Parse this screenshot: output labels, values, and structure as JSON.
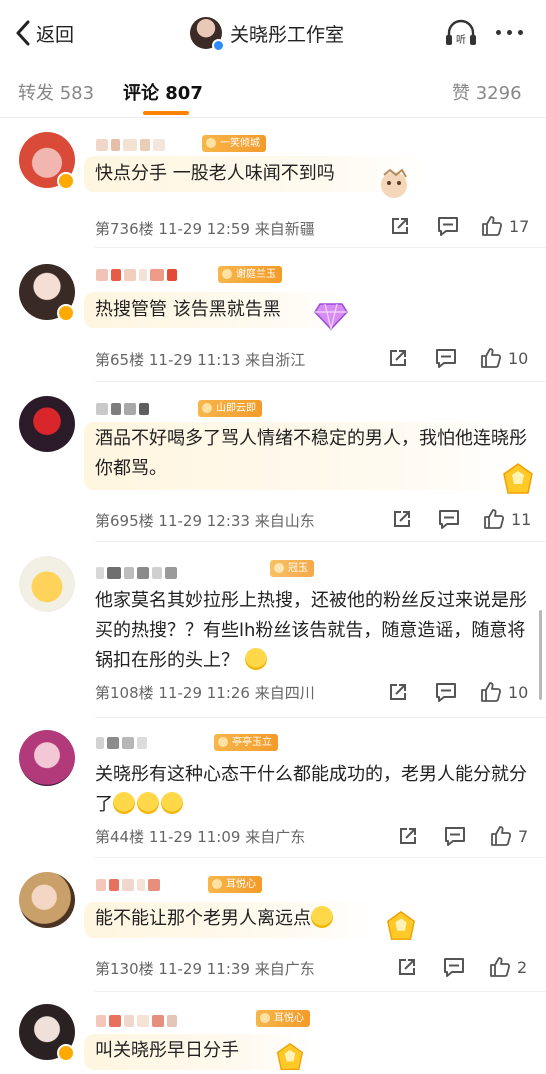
{
  "header": {
    "back_label": "返回",
    "title": "关晓彤工作室",
    "listen_label": "听"
  },
  "tabs": [
    {
      "label": "转发",
      "count": "583"
    },
    {
      "label": "评论",
      "count": "807"
    },
    {
      "label": "赞",
      "count": "3296"
    }
  ],
  "tab_labels": {
    "forward": "转发 583",
    "comments": "评论 807",
    "likes": "赞 3296"
  },
  "colors": {
    "accent": "#ff8200",
    "fan_badge": "#f5a93a",
    "verified": "#2f8cff"
  },
  "comments": [
    {
      "badge": "一笑倾城",
      "text": "快点分手 一股老人味闻不到吗",
      "floor": "第736楼",
      "date": "11-29 12:59",
      "location": "来自新疆",
      "likes": "17",
      "meta": "第736楼 11-29 12:59 来自新疆"
    },
    {
      "badge": "谢庭兰玉",
      "text": "热搜管管 该告黑就告黑",
      "floor": "第65楼",
      "date": "11-29 11:13",
      "location": "来自浙江",
      "likes": "10",
      "meta": "第65楼 11-29 11:13 来自浙江"
    },
    {
      "badge": "山即云即",
      "text": "酒品不好喝多了骂人情绪不稳定的男人，我怕他连晓彤你都骂。",
      "floor": "第695楼",
      "date": "11-29 12:33",
      "location": "来自山东",
      "likes": "11",
      "meta": "第695楼 11-29 12:33 来自山东"
    },
    {
      "badge": "冠玉",
      "text": "他家莫名其妙拉彤上热搜，还被他的粉丝反过来说是彤买的热搜？？有些lh粉丝该告就告，随意造谣，随意将锅扣在彤的头上？",
      "floor": "第108楼",
      "date": "11-29 11:26",
      "location": "来自四川",
      "likes": "10",
      "meta": "第108楼 11-29 11:26 来自四川"
    },
    {
      "badge": "亭亭玉立",
      "text": "关晓彤有这种心态干什么都能成功的，老男人能分就分了",
      "floor": "第44楼",
      "date": "11-29 11:09",
      "location": "来自广东",
      "likes": "7",
      "meta": "第44楼 11-29 11:09 来自广东"
    },
    {
      "badge": "耳悦心",
      "text": "能不能让那个老男人离远点",
      "floor": "第130楼",
      "date": "11-29 11:39",
      "location": "来自广东",
      "likes": "2",
      "meta": "第130楼 11-29 11:39 来自广东"
    },
    {
      "badge": "耳悦心",
      "text": "叫关晓彤早日分手",
      "floor": "",
      "date": "",
      "location": "",
      "likes": "",
      "meta": ""
    }
  ],
  "icons": [
    "chevron-left-icon",
    "listen-icon",
    "more-icon",
    "share-icon",
    "comment-icon",
    "like-icon",
    "verified-icon",
    "emoji-icon",
    "sticker-icon"
  ]
}
